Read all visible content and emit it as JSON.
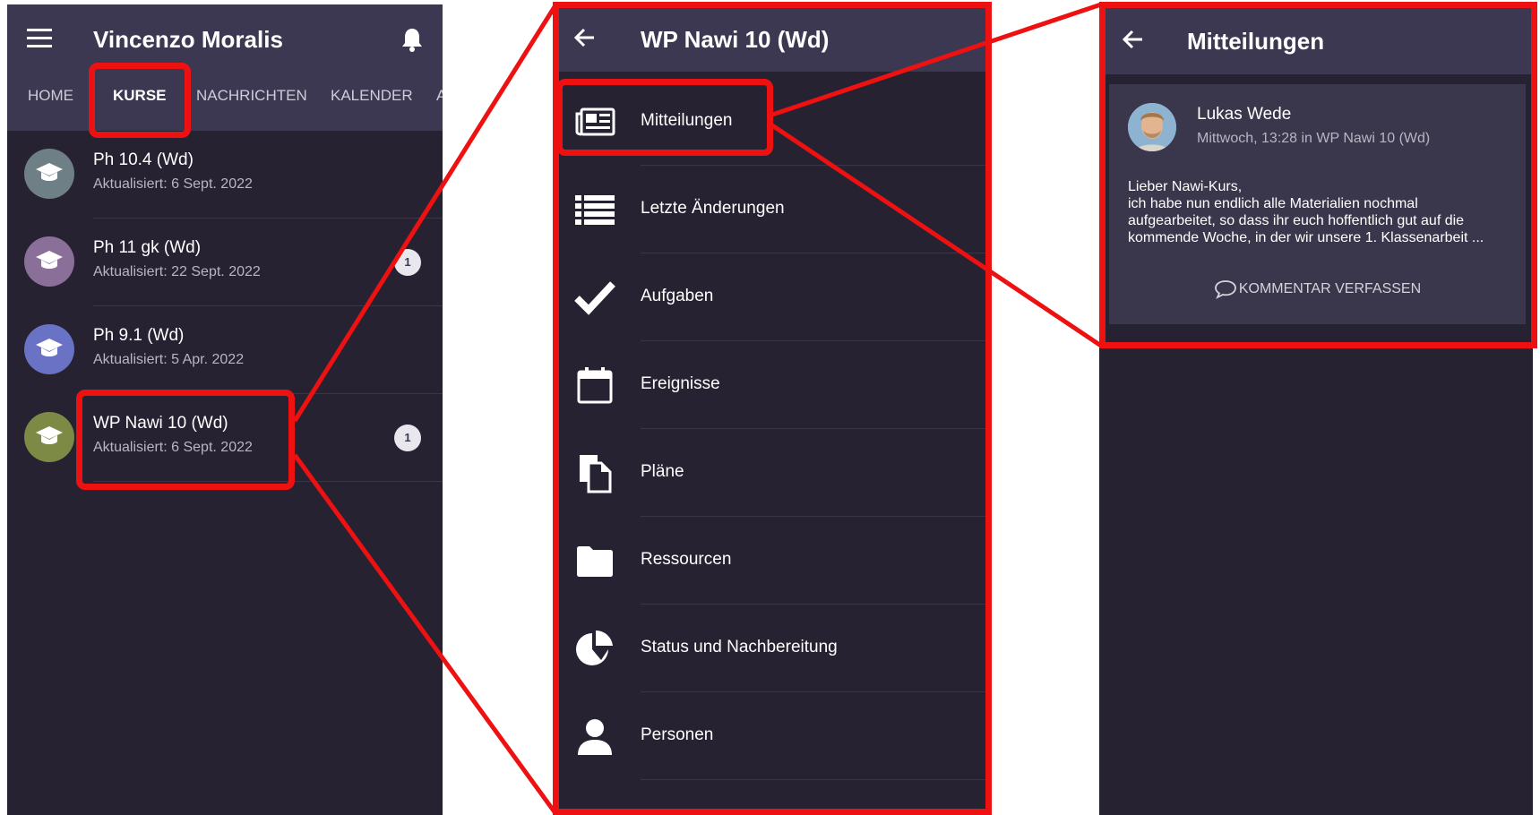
{
  "colors": {
    "background": "#262231",
    "topbar": "#3d3851",
    "card": "#3a364b",
    "highlight": "#ee1111"
  },
  "screen1": {
    "title": "Vincenzo Moralis",
    "menu_icon": "hamburger-menu-icon",
    "notification_icon": "bell-icon",
    "tabs": [
      {
        "label": "HOME",
        "active": false
      },
      {
        "label": "KURSE",
        "active": true
      },
      {
        "label": "NACHRICHTEN",
        "active": false
      },
      {
        "label": "KALENDER",
        "active": false
      },
      {
        "label": "A",
        "active": false
      }
    ],
    "courses": [
      {
        "name": "Ph 10.4 (Wd)",
        "updated": "Aktualisiert: 6 Sept. 2022",
        "color": "#6f7f86",
        "badge": ""
      },
      {
        "name": "Ph 11 gk (Wd)",
        "updated": "Aktualisiert: 22 Sept. 2022",
        "color": "#8a6f99",
        "badge": "1"
      },
      {
        "name": "Ph 9.1 (Wd)",
        "updated": "Aktualisiert: 5 Apr. 2022",
        "color": "#6a72c6",
        "badge": ""
      },
      {
        "name": "WP Nawi 10 (Wd)",
        "updated": "Aktualisiert: 6 Sept. 2022",
        "color": "#7d8a45",
        "badge": "1"
      }
    ]
  },
  "screen2": {
    "title": "WP Nawi 10 (Wd)",
    "menu": [
      {
        "label": "Mitteilungen",
        "icon": "newspaper-icon"
      },
      {
        "label": "Letzte Änderungen",
        "icon": "list-icon"
      },
      {
        "label": "Aufgaben",
        "icon": "checkmark-icon"
      },
      {
        "label": "Ereignisse",
        "icon": "calendar-icon"
      },
      {
        "label": "Pläne",
        "icon": "documents-icon"
      },
      {
        "label": "Ressourcen",
        "icon": "folder-icon"
      },
      {
        "label": "Status und Nachbereitung",
        "icon": "pie-chart-icon"
      },
      {
        "label": "Personen",
        "icon": "person-icon"
      }
    ]
  },
  "screen3": {
    "title": "Mitteilungen",
    "post": {
      "author": "Lukas Wede",
      "meta": "Mittwoch, 13:28 in WP Nawi 10 (Wd)",
      "lines": [
        "Lieber Nawi-Kurs,",
        "ich habe nun endlich alle Materialien nochmal",
        "aufgearbeitet, so dass ihr euch hoffentlich gut auf die",
        "kommende Woche, in der wir unsere 1. Klassenarbeit ..."
      ],
      "comment_label": "KOMMENTAR VERFASSEN"
    }
  }
}
